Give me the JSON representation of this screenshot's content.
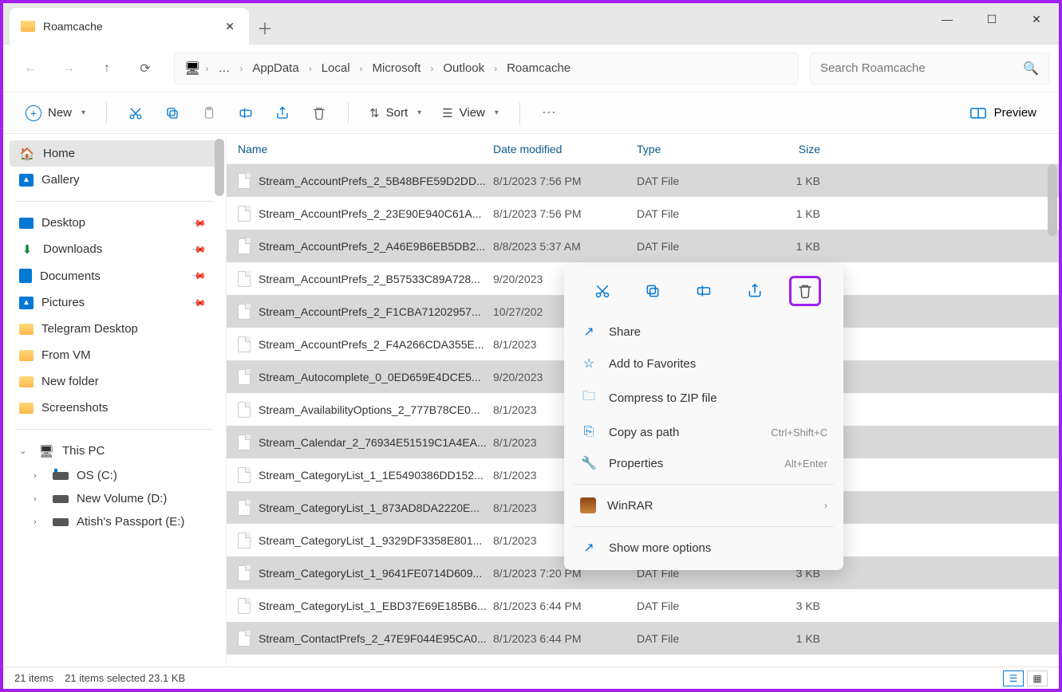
{
  "window": {
    "title": "Roamcache"
  },
  "breadcrumb": [
    "AppData",
    "Local",
    "Microsoft",
    "Outlook",
    "Roamcache"
  ],
  "search": {
    "placeholder": "Search Roamcache"
  },
  "toolbar": {
    "new": "New",
    "sort": "Sort",
    "view": "View",
    "preview": "Preview"
  },
  "sidebar": {
    "home": "Home",
    "gallery": "Gallery",
    "quick": [
      "Desktop",
      "Downloads",
      "Documents",
      "Pictures",
      "Telegram Desktop",
      "From VM",
      "New folder",
      "Screenshots"
    ],
    "thispc": "This PC",
    "drives": [
      "OS (C:)",
      "New Volume (D:)",
      "Atish's Passport  (E:)"
    ]
  },
  "columns": {
    "name": "Name",
    "date": "Date modified",
    "type": "Type",
    "size": "Size"
  },
  "files": [
    {
      "name": "Stream_AccountPrefs_2_5B48BFE59D2DD...",
      "date": "8/1/2023 7:56 PM",
      "type": "DAT File",
      "size": "1 KB",
      "sel": true
    },
    {
      "name": "Stream_AccountPrefs_2_23E90E940C61A...",
      "date": "8/1/2023 7:56 PM",
      "type": "DAT File",
      "size": "1 KB",
      "sel": false
    },
    {
      "name": "Stream_AccountPrefs_2_A46E9B6EB5DB2...",
      "date": "8/8/2023 5:37 AM",
      "type": "DAT File",
      "size": "1 KB",
      "sel": true
    },
    {
      "name": "Stream_AccountPrefs_2_B57533C89A728...",
      "date": "9/20/2023",
      "type": "",
      "size": "",
      "sel": false
    },
    {
      "name": "Stream_AccountPrefs_2_F1CBA71202957...",
      "date": "10/27/202",
      "type": "",
      "size": "",
      "sel": true
    },
    {
      "name": "Stream_AccountPrefs_2_F4A266CDA355E...",
      "date": "8/1/2023",
      "type": "",
      "size": "",
      "sel": false
    },
    {
      "name": "Stream_Autocomplete_0_0ED659E4DCE5...",
      "date": "9/20/2023",
      "type": "",
      "size": "",
      "sel": true
    },
    {
      "name": "Stream_AvailabilityOptions_2_777B78CE0...",
      "date": "8/1/2023",
      "type": "",
      "size": "",
      "sel": false
    },
    {
      "name": "Stream_Calendar_2_76934E51519C1A4EA...",
      "date": "8/1/2023",
      "type": "",
      "size": "",
      "sel": true
    },
    {
      "name": "Stream_CategoryList_1_1E5490386DD152...",
      "date": "8/1/2023",
      "type": "",
      "size": "",
      "sel": false
    },
    {
      "name": "Stream_CategoryList_1_873AD8DA2220E...",
      "date": "8/1/2023",
      "type": "",
      "size": "",
      "sel": true
    },
    {
      "name": "Stream_CategoryList_1_9329DF3358E801...",
      "date": "8/1/2023",
      "type": "",
      "size": "",
      "sel": false
    },
    {
      "name": "Stream_CategoryList_1_9641FE0714D609...",
      "date": "8/1/2023 7:20 PM",
      "type": "DAT File",
      "size": "3 KB",
      "sel": true
    },
    {
      "name": "Stream_CategoryList_1_EBD37E69E185B6...",
      "date": "8/1/2023 6:44 PM",
      "type": "DAT File",
      "size": "3 KB",
      "sel": false
    },
    {
      "name": "Stream_ContactPrefs_2_47E9F044E95CA0...",
      "date": "8/1/2023 6:44 PM",
      "type": "DAT File",
      "size": "1 KB",
      "sel": true
    }
  ],
  "context_menu": {
    "share": "Share",
    "favorites": "Add to Favorites",
    "zip": "Compress to ZIP file",
    "copypath": "Copy as path",
    "copypath_key": "Ctrl+Shift+C",
    "properties": "Properties",
    "properties_key": "Alt+Enter",
    "winrar": "WinRAR",
    "more": "Show more options"
  },
  "status": {
    "count": "21 items",
    "selected": "21 items selected  23.1 KB"
  }
}
